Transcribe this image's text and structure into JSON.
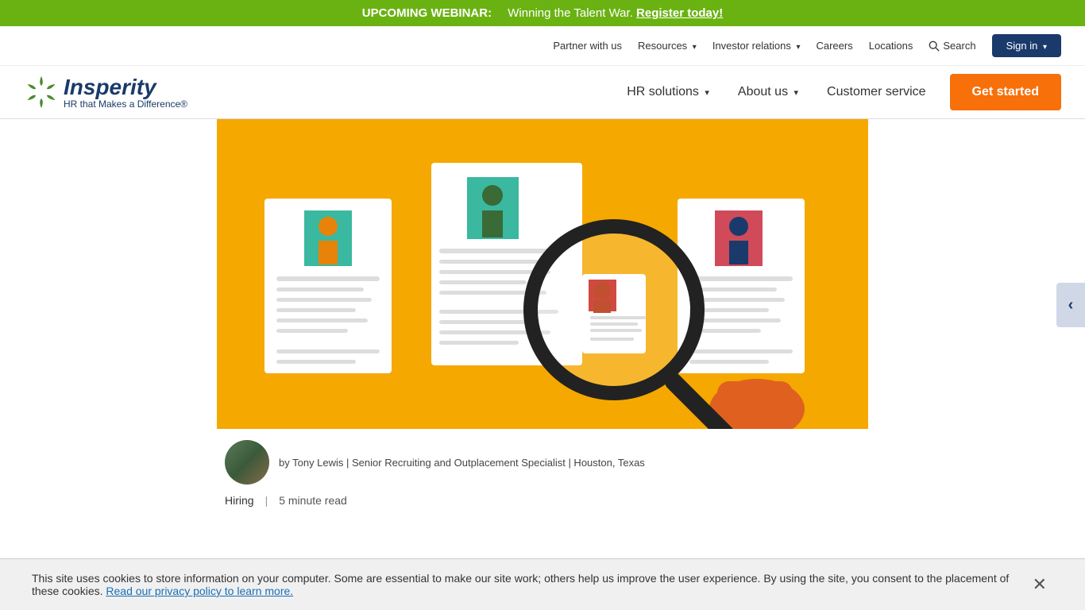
{
  "topBanner": {
    "label": "UPCOMING WEBINAR:",
    "text": "Winning the Talent War.",
    "linkText": "Register today!",
    "linkHref": "#"
  },
  "secondaryNav": {
    "items": [
      {
        "label": "Partner with us",
        "dropdown": false
      },
      {
        "label": "Resources",
        "dropdown": true
      },
      {
        "label": "Investor relations",
        "dropdown": true
      },
      {
        "label": "Careers",
        "dropdown": false
      },
      {
        "label": "Locations",
        "dropdown": false
      },
      {
        "label": "Search",
        "isSearch": true
      },
      {
        "label": "Sign in",
        "isSignIn": true,
        "dropdown": true
      }
    ]
  },
  "primaryNav": {
    "logo": {
      "mainText": "Insperity",
      "subText": "HR that Makes a Difference®"
    },
    "links": [
      {
        "label": "HR solutions",
        "dropdown": true
      },
      {
        "label": "About us",
        "dropdown": true
      },
      {
        "label": "Customer service",
        "dropdown": false
      }
    ],
    "ctaLabel": "Get started"
  },
  "article": {
    "authorName": "Tony Lewis",
    "authorTitle": "Senior Recruiting and Outplacement Specialist",
    "authorLocation": "Houston, Texas",
    "authorByLine": "by Tony Lewis | Senior Recruiting and Outplacement Specialist | Houston, Texas",
    "category": "Hiring",
    "readTime": "5 minute read"
  },
  "cookieBanner": {
    "text": "This site uses cookies to store information on your computer. Some are essential to make our site work; others help us improve the user experience. By using the site, you consent to the placement of these cookies.",
    "linkText": "Read our privacy policy to learn more.",
    "linkHref": "#"
  }
}
